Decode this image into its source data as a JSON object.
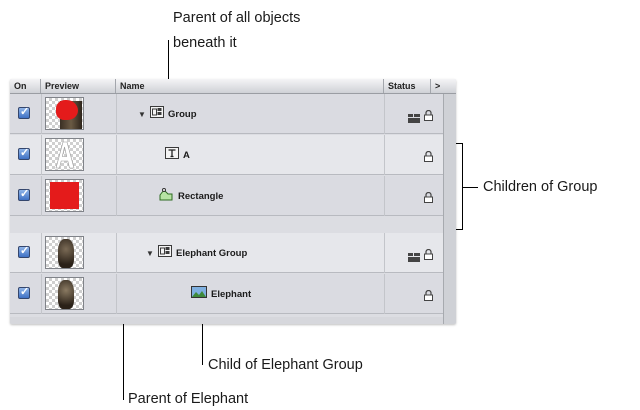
{
  "callouts": {
    "parent_of_all": [
      "Parent of all objects",
      "beneath it"
    ],
    "children_of_group": "Children of Group",
    "child_of_elephant_group": "Child of Elephant Group",
    "parent_of_elephant": "Parent of Elephant"
  },
  "panel": {
    "columns": {
      "on": "On",
      "preview": "Preview",
      "name": "Name",
      "status": "Status",
      "more": ">"
    },
    "rows": [
      {
        "name": "Group",
        "checked": true,
        "icon": "group-icon",
        "expanded": true,
        "preview": "red-blob-elephant-thumbnail",
        "status_icons": [
          "layers-icon",
          "lock-icon"
        ]
      },
      {
        "name": "A",
        "checked": true,
        "icon": "text-layer-icon",
        "preview": "white-letter-a-thumbnail",
        "status_icons": [
          "lock-icon"
        ]
      },
      {
        "name": "Rectangle",
        "checked": true,
        "icon": "shape-icon",
        "preview": "red-square-thumbnail",
        "status_icons": [
          "lock-icon"
        ]
      },
      {
        "name": "Elephant Group",
        "checked": true,
        "icon": "group-icon",
        "expanded": true,
        "preview": "elephant-thumbnail",
        "status_icons": [
          "layers-icon",
          "lock-icon"
        ]
      },
      {
        "name": "Elephant",
        "checked": true,
        "icon": "image-layer-icon",
        "preview": "elephant-thumbnail",
        "status_icons": [
          "lock-icon"
        ]
      }
    ]
  },
  "colors": {
    "checkbox": "#3f71c4",
    "red_object": "#e41b1b",
    "panel_bg": "#dcdde2"
  }
}
